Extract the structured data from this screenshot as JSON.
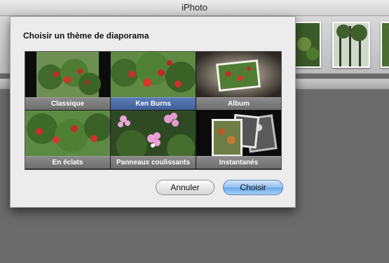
{
  "window": {
    "title": "iPhoto"
  },
  "dialog": {
    "title": "Choisir un thème de diaporama",
    "themes": [
      {
        "label": "Classique",
        "selected": false
      },
      {
        "label": "Ken Burns",
        "selected": true
      },
      {
        "label": "Album",
        "selected": false
      },
      {
        "label": "En éclats",
        "selected": false
      },
      {
        "label": "Panneaux coulissants",
        "selected": false
      },
      {
        "label": "Instantanés",
        "selected": false
      }
    ],
    "cancel_label": "Annuler",
    "ok_label": "Choisir"
  },
  "colors": {
    "selection": "#4a6aa5",
    "label_bar": "#7a7a7a",
    "default_button": "#7fb3ef"
  }
}
